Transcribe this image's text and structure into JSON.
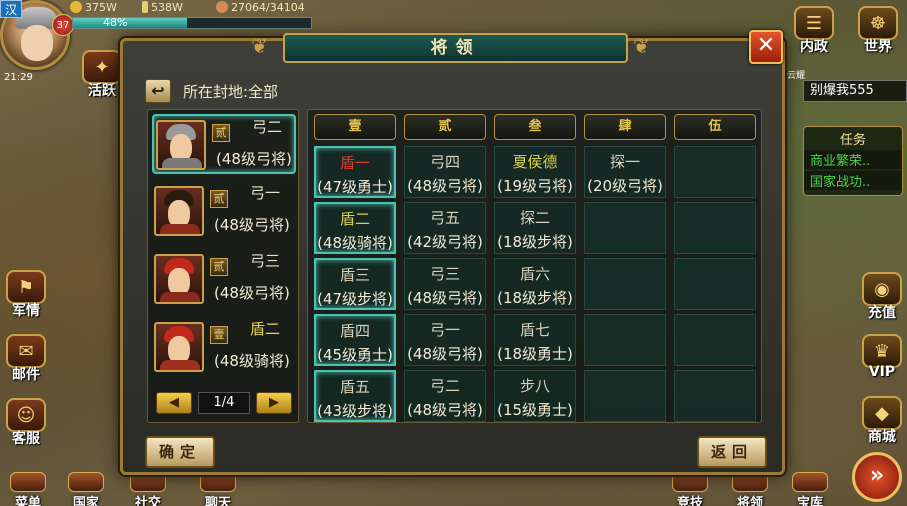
{
  "hud": {
    "nation": "汉",
    "level": "37",
    "gold": "375W",
    "grain": "538W",
    "troops": "27064/34104",
    "exp_percent": "48%",
    "exp_fraction": 0.48,
    "clock": "21:29"
  },
  "left_buttons": [
    {
      "label": "活跃",
      "icon": "gift-box-icon"
    },
    {
      "label": "军情",
      "icon": "military-report-icon"
    },
    {
      "label": "邮件",
      "icon": "mail-scroll-icon"
    },
    {
      "label": "客服",
      "icon": "service-maiden-icon"
    }
  ],
  "bottom_buttons": [
    {
      "label": "菜单",
      "icon": "menu-icon"
    },
    {
      "label": "国家",
      "icon": "palace-icon"
    },
    {
      "label": "社交",
      "icon": "social-icon"
    },
    {
      "label": "聊天",
      "icon": "chat-icon"
    },
    {
      "label": "竞技",
      "icon": "arena-icon"
    },
    {
      "label": "将领",
      "icon": "general-icon"
    },
    {
      "label": "宝库",
      "icon": "treasure-icon"
    }
  ],
  "right_buttons": [
    {
      "label": "内政",
      "icon": "scroll-bundle-icon"
    },
    {
      "label": "世界",
      "icon": "dragon-world-icon"
    },
    {
      "label": "充值",
      "icon": "coin-stack-icon"
    },
    {
      "label": "VIP",
      "icon": "vip-card-icon"
    },
    {
      "label": "商城",
      "icon": "gold-ingot-icon"
    }
  ],
  "chat": {
    "tag": "云耀",
    "text": "别爆我555"
  },
  "tasks": {
    "title": "任务",
    "items": [
      "商业繁荣..",
      "国家战功.."
    ]
  },
  "modal": {
    "title": "将领",
    "fief_label": "所在封地:全部",
    "confirm_label": "确定",
    "back_label": "返回",
    "close_glyph": "✕"
  },
  "general_list": {
    "generals": [
      {
        "name": "弓二",
        "rank": "贰",
        "info": "(48级弓将)",
        "name_color": "normal",
        "hair": "#9a9a9a",
        "body": "#7a7a7a",
        "selected": true
      },
      {
        "name": "弓一",
        "rank": "贰",
        "info": "(48级弓将)",
        "name_color": "normal",
        "hair": "#2a1a10",
        "body": "#8a2a1a",
        "selected": false
      },
      {
        "name": "弓三",
        "rank": "贰",
        "info": "(48级弓将)",
        "name_color": "normal",
        "hair": "#c2281c",
        "body": "#8a2a1a",
        "selected": false
      },
      {
        "name": "盾二",
        "rank": "壹",
        "info": "(48级骑将)",
        "name_color": "yellow",
        "hair": "#c2281c",
        "body": "#a03020",
        "selected": false
      }
    ],
    "page": "1/4",
    "prev_glyph": "◀",
    "next_glyph": "▶"
  },
  "formation": {
    "columns": [
      "壹",
      "贰",
      "叁",
      "肆",
      "伍"
    ],
    "rows": [
      [
        {
          "name": "盾一",
          "info": "(47级勇士)",
          "color": "red",
          "selected": true
        },
        {
          "name": "弓四",
          "info": "(48级弓将)",
          "color": "normal"
        },
        {
          "name": "夏侯德",
          "info": "(19级弓将)",
          "color": "yellow"
        },
        {
          "name": "探一",
          "info": "(20级弓将)",
          "color": "normal"
        },
        null
      ],
      [
        {
          "name": "盾二",
          "info": "(48级骑将)",
          "color": "yellow",
          "selected": true
        },
        {
          "name": "弓五",
          "info": "(42级弓将)",
          "color": "normal"
        },
        {
          "name": "探二",
          "info": "(18级步将)",
          "color": "normal"
        },
        null,
        null
      ],
      [
        {
          "name": "盾三",
          "info": "(47级步将)",
          "color": "normal",
          "selected": true
        },
        {
          "name": "弓三",
          "info": "(48级弓将)",
          "color": "normal"
        },
        {
          "name": "盾六",
          "info": "(18级步将)",
          "color": "normal"
        },
        null,
        null
      ],
      [
        {
          "name": "盾四",
          "info": "(45级勇士)",
          "color": "normal",
          "selected": true
        },
        {
          "name": "弓一",
          "info": "(48级弓将)",
          "color": "normal"
        },
        {
          "name": "盾七",
          "info": "(18级勇士)",
          "color": "normal"
        },
        null,
        null
      ],
      [
        {
          "name": "盾五",
          "info": "(43级步将)",
          "color": "normal",
          "selected": true
        },
        {
          "name": "弓二",
          "info": "(48级弓将)",
          "color": "normal"
        },
        {
          "name": "步八",
          "info": "(15级勇士)",
          "color": "normal"
        },
        null,
        null
      ]
    ]
  }
}
